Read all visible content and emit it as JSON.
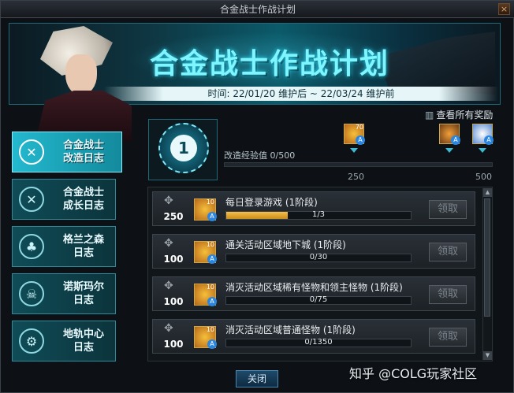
{
  "window": {
    "title": "合金战士作战计划",
    "close_glyph": "×"
  },
  "banner": {
    "title": "合金战士作战计划",
    "date": "时间: 22/01/20 维护后 ~ 22/03/24 维护前"
  },
  "sidebar": {
    "items": [
      {
        "label1": "合金战士",
        "label2": "改造日志",
        "active": true
      },
      {
        "label1": "合金战士",
        "label2": "成长日志",
        "active": false
      },
      {
        "label1": "格兰之森",
        "label2": "日志",
        "active": false
      },
      {
        "label1": "诺斯玛尔",
        "label2": "日志",
        "active": false
      },
      {
        "label1": "地轨中心",
        "label2": "日志",
        "active": false
      }
    ]
  },
  "progress": {
    "level": "1",
    "all_rewards": "查看所有奖励",
    "exp_label": "改造经验值",
    "exp_value": "0/500",
    "exp_fraction": 0.0,
    "marks": [
      "250",
      "500"
    ],
    "reward_counts": [
      "70"
    ]
  },
  "tasks": [
    {
      "score": "250",
      "icon_count": "10",
      "name": "每日登录游戏 (1阶段)",
      "progress": "1/3",
      "fraction": 0.333,
      "button": "领取"
    },
    {
      "score": "100",
      "icon_count": "10",
      "name": "通关活动区域地下城 (1阶段)",
      "progress": "0/30",
      "fraction": 0.0,
      "button": "领取"
    },
    {
      "score": "100",
      "icon_count": "10",
      "name": "消灭活动区域稀有怪物和领主怪物 (1阶段)",
      "progress": "0/75",
      "fraction": 0.0,
      "button": "领取"
    },
    {
      "score": "100",
      "icon_count": "10",
      "name": "消灭活动区域普通怪物 (1阶段)",
      "progress": "0/1350",
      "fraction": 0.0,
      "button": "领取"
    }
  ],
  "footer": {
    "close": "关闭"
  },
  "watermark": "知乎 @COLG玩家社区",
  "colors": {
    "accent": "#5cd7ea",
    "progress": "#f6c04a"
  }
}
